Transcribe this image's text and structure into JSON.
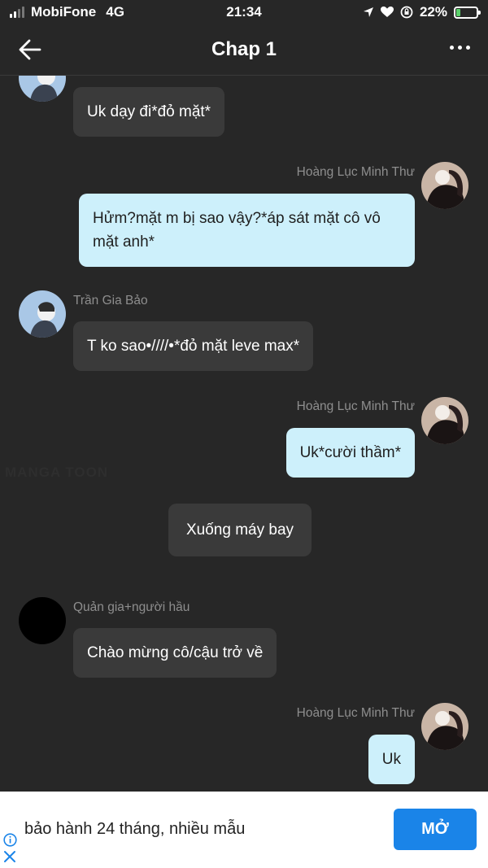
{
  "status_bar": {
    "carrier": "MobiFone",
    "network": "4G",
    "time": "21:34",
    "battery_percent": "22%",
    "battery_level": 0.22
  },
  "nav": {
    "title": "Chap 1",
    "back_icon": "arrow-left-icon",
    "more_icon": "more-dots-icon"
  },
  "messages": [
    {
      "side": "left",
      "sender": "",
      "text": "Uk dạy đi*đỏ mặt*"
    },
    {
      "side": "right",
      "sender": "Hoàng Lục Minh Thư",
      "text": "Hửm?mặt m bị sao vậy?*áp sát mặt cô vô mặt anh*"
    },
    {
      "side": "left",
      "sender": "Trần Gia Bảo",
      "text": "T ko sao•////•*đỏ mặt leve max*"
    },
    {
      "side": "right",
      "sender": "Hoàng Lục Minh Thư",
      "text": "Uk*cười thầm*"
    },
    {
      "side": "center",
      "sender": "",
      "text": "Xuống máy bay"
    },
    {
      "side": "left",
      "sender": "Quản gia+người hầu",
      "text": "Chào mừng cô/cậu trở về"
    },
    {
      "side": "right",
      "sender": "Hoàng Lục Minh Thư",
      "text": "Uk"
    }
  ],
  "watermark": "MANGA TOON",
  "ad": {
    "text": "bảo hành 24 tháng, nhiều mẫu",
    "button_label": "MỞ",
    "info_icon": "info-icon",
    "close_icon": "close-icon"
  },
  "colors": {
    "background": "#272727",
    "left_bubble": "#3a3a3a",
    "right_bubble": "#cdf0fb",
    "ad_button": "#1a84e8"
  }
}
